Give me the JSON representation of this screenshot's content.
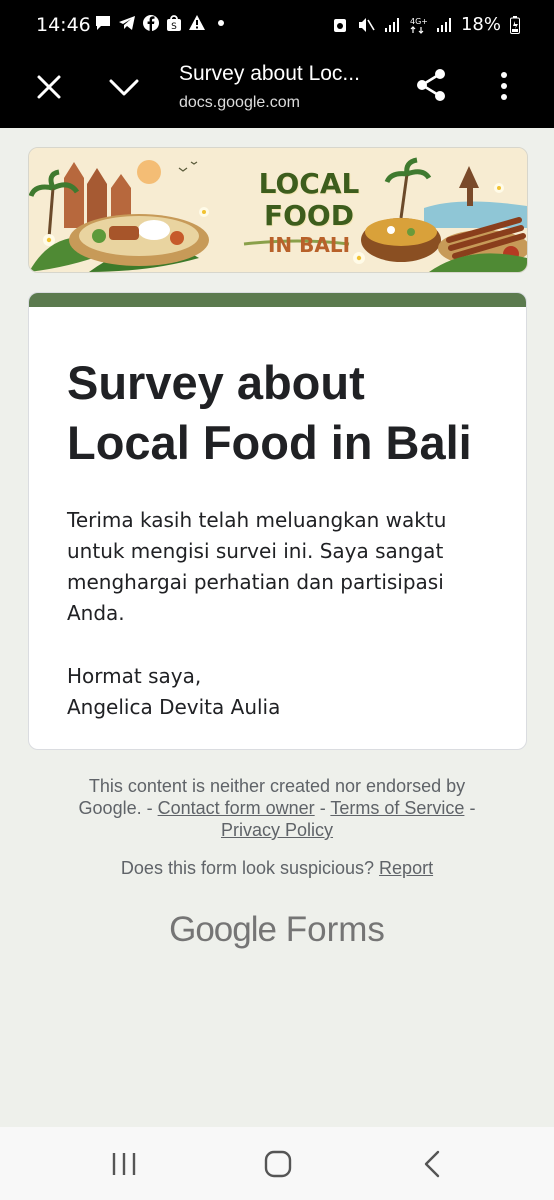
{
  "status_bar": {
    "time": "14:46",
    "battery": "18%",
    "icons_left": [
      "chat-bubble-icon",
      "telegram-icon",
      "facebook-icon",
      "shopee-icon",
      "warning-icon",
      "dot-icon"
    ],
    "icons_right": [
      "alarm-icon",
      "mute-icon",
      "signal-icon",
      "4g-icon",
      "signal-icon",
      "battery-icon"
    ]
  },
  "app_bar": {
    "title": "Survey about Loc...",
    "url": "docs.google.com"
  },
  "banner": {
    "title_line1": "LOCAL FOOD",
    "title_line2": "IN BALI"
  },
  "form": {
    "accent_color": "#5b7a4e",
    "title_line1": "Survey about",
    "title_line2": "Local Food in Bali",
    "description_lines": [
      "Terima kasih telah meluangkan waktu",
      "untuk mengisi survei ini. Saya sangat",
      "menghargai perhatian dan partisipasi",
      "Anda."
    ],
    "sign_off": "Hormat saya,",
    "author": "Angelica Devita Aulia"
  },
  "footer": {
    "disclaimer_prefix": "This content is neither created nor endorsed by Google. -",
    "contact_link": "Contact form owner",
    "sep1": "-",
    "terms_link": "Terms of Service",
    "sep2": "-",
    "privacy_link": "Privacy Policy",
    "suspicious_text": "Does this form look suspicious?",
    "report_link": "Report",
    "logo_google": "Google",
    "logo_forms": "Forms"
  }
}
